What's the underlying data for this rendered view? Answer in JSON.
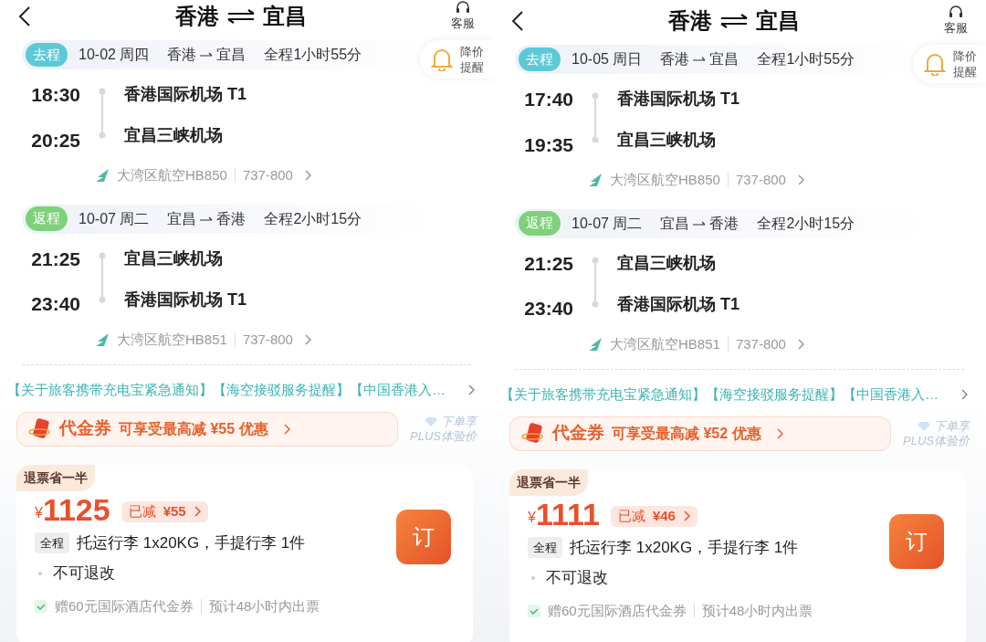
{
  "panels": [
    {
      "header": {
        "from": "香港",
        "to": "宜昌",
        "service": "客服"
      },
      "price_alert": "降价提醒",
      "segments": [
        {
          "tag": "去程",
          "color": "#5cc9d6",
          "date": "10-02 周四",
          "from": "香港",
          "to": "宜昌",
          "duration": "全程1小时55分",
          "departure_time": "18:30",
          "departure_airport": "香港国际机场 T1",
          "arrival_time": "20:25",
          "arrival_airport": "宜昌三峡机场",
          "airline": "大湾区航空HB850",
          "aircraft": "737-800"
        },
        {
          "tag": "返程",
          "color": "#7fd07a",
          "date": "10-07 周二",
          "from": "宜昌",
          "to": "香港",
          "duration": "全程2小时15分",
          "departure_time": "21:25",
          "departure_airport": "宜昌三峡机场",
          "arrival_time": "23:40",
          "arrival_airport": "香港国际机场 T1",
          "airline": "大湾区航空HB851",
          "aircraft": "737-800"
        }
      ],
      "notice": "【关于旅客携带充电宝紧急通知】【海空接驳服务提醒】【中国香港入…",
      "coupon": {
        "label": "代金券",
        "text": "可享受最高减 ¥55 优惠"
      },
      "plus": [
        "下单享",
        "PLUS体验价"
      ],
      "fare": {
        "badge": "退票省一半",
        "currency": "¥",
        "price": "1125",
        "discount_label": "已减",
        "discount_amount": "¥55",
        "book": "订",
        "baggage_tag": "全程",
        "baggage": "托运行李 1x20KG，手提行李 1件",
        "rule": "不可退改",
        "perks": [
          "赠60元国际酒店代金券",
          "预计48小时内出票"
        ]
      }
    },
    {
      "header": {
        "from": "香港",
        "to": "宜昌",
        "service": "客服"
      },
      "price_alert": "降价提醒",
      "segments": [
        {
          "tag": "去程",
          "color": "#5cc9d6",
          "date": "10-05 周日",
          "from": "香港",
          "to": "宜昌",
          "duration": "全程1小时55分",
          "departure_time": "17:40",
          "departure_airport": "香港国际机场 T1",
          "arrival_time": "19:35",
          "arrival_airport": "宜昌三峡机场",
          "airline": "大湾区航空HB850",
          "aircraft": "737-800"
        },
        {
          "tag": "返程",
          "color": "#7fd07a",
          "date": "10-07 周二",
          "from": "宜昌",
          "to": "香港",
          "duration": "全程2小时15分",
          "departure_time": "21:25",
          "departure_airport": "宜昌三峡机场",
          "arrival_time": "23:40",
          "arrival_airport": "香港国际机场 T1",
          "airline": "大湾区航空HB851",
          "aircraft": "737-800"
        }
      ],
      "notice": "【关于旅客携带充电宝紧急通知】【海空接驳服务提醒】【中国香港入…",
      "coupon": {
        "label": "代金券",
        "text": "可享受最高减 ¥52 优惠"
      },
      "plus": [
        "下单享",
        "PLUS体验价"
      ],
      "fare": {
        "badge": "退票省一半",
        "currency": "¥",
        "price": "1111",
        "discount_label": "已减",
        "discount_amount": "¥46",
        "book": "订",
        "baggage_tag": "全程",
        "baggage": "托运行李 1x20KG，手提行李 1件",
        "rule": "不可退改",
        "perks": [
          "赠60元国际酒店代金券",
          "预计48小时内出票"
        ]
      }
    }
  ]
}
